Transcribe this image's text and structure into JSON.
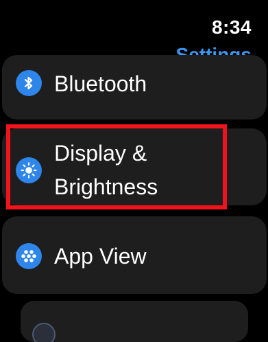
{
  "status": {
    "time": "8:34"
  },
  "header": {
    "title": "Settings"
  },
  "settings_list": {
    "items": [
      {
        "label": "Bluetooth",
        "icon": "bluetooth-icon"
      },
      {
        "label": "Display &\nBrightness",
        "icon": "brightness-icon"
      },
      {
        "label": "App View",
        "icon": "app-grid-icon"
      },
      {
        "label": "",
        "icon": "partial-icon"
      }
    ]
  },
  "annotation": {
    "highlight_target": "Display & Brightness",
    "highlight_color": "#f0131b"
  },
  "colors": {
    "accent": "#3a96f0",
    "row_background": "#1e1e1f",
    "icon_background": "#2f86ea",
    "background": "#000000"
  }
}
